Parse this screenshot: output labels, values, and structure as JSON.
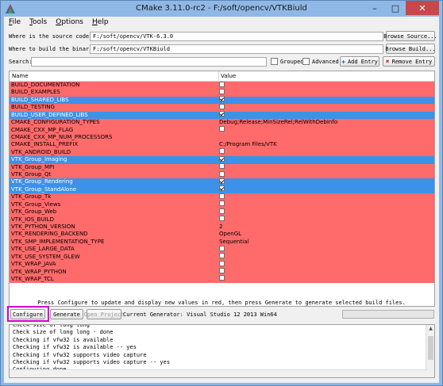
{
  "window": {
    "title": "CMake 3.11.0-rc2 - F:/soft/opencv/VTKBiuld"
  },
  "menu": [
    {
      "key": "F",
      "rest": "ile"
    },
    {
      "key": "T",
      "rest": "ools"
    },
    {
      "key": "O",
      "rest": "ptions"
    },
    {
      "key": "H",
      "rest": "elp"
    }
  ],
  "source": {
    "label": "Where is the source code:",
    "value": "F:/soft/opencv/VTK-6.3.0",
    "browse_label": "Browse Source..."
  },
  "build": {
    "label": "Where to build the binaries:",
    "value": "F:/soft/opencv/VTKBiuld",
    "browse_label": "Browse Build..."
  },
  "search": {
    "label": "Search:",
    "value": "",
    "grouped_label": "Grouped",
    "advanced_label": "Advanced",
    "add_label": "Add Entry",
    "remove_label": "Remove Entry"
  },
  "table": {
    "col_name": "Name",
    "col_value": "Value",
    "rows": [
      {
        "name": "BUILD_DOCUMENTATION",
        "type": "bool",
        "checked": false,
        "selected": false
      },
      {
        "name": "BUILD_EXAMPLES",
        "type": "bool",
        "checked": false,
        "selected": false
      },
      {
        "name": "BUILD_SHARED_LIBS",
        "type": "bool",
        "checked": true,
        "selected": true
      },
      {
        "name": "BUILD_TESTING",
        "type": "bool",
        "checked": false,
        "selected": false
      },
      {
        "name": "BUILD_USER_DEFINED_LIBS",
        "type": "bool",
        "checked": true,
        "selected": true
      },
      {
        "name": "CMAKE_CONFIGURATION_TYPES",
        "type": "text",
        "value": "Debug;Release;MinSizeRel;RelWithDebInfo",
        "selected": false
      },
      {
        "name": "CMAKE_CXX_MP_FLAG",
        "type": "bool",
        "checked": false,
        "selected": false
      },
      {
        "name": "CMAKE_CXX_MP_NUM_PROCESSORS",
        "type": "text",
        "value": "",
        "selected": false
      },
      {
        "name": "CMAKE_INSTALL_PREFIX",
        "type": "text",
        "value": "C:/Program Files/VTK",
        "selected": false
      },
      {
        "name": "VTK_ANDROID_BUILD",
        "type": "bool",
        "checked": false,
        "selected": false
      },
      {
        "name": "VTK_Group_Imaging",
        "type": "bool",
        "checked": true,
        "selected": true
      },
      {
        "name": "VTK_Group_MPI",
        "type": "bool",
        "checked": false,
        "selected": false
      },
      {
        "name": "VTK_Group_Qt",
        "type": "bool",
        "checked": false,
        "selected": false
      },
      {
        "name": "VTK_Group_Rendering",
        "type": "bool",
        "checked": true,
        "selected": true
      },
      {
        "name": "VTK_Group_StandAlone",
        "type": "bool",
        "checked": true,
        "selected": true
      },
      {
        "name": "VTK_Group_Tk",
        "type": "bool",
        "checked": false,
        "selected": false
      },
      {
        "name": "VTK_Group_Views",
        "type": "bool",
        "checked": false,
        "selected": false
      },
      {
        "name": "VTK_Group_Web",
        "type": "bool",
        "checked": false,
        "selected": false
      },
      {
        "name": "VTK_IOS_BUILD",
        "type": "bool",
        "checked": false,
        "selected": false
      },
      {
        "name": "VTK_PYTHON_VERSION",
        "type": "text",
        "value": "2",
        "selected": false
      },
      {
        "name": "VTK_RENDERING_BACKEND",
        "type": "text",
        "value": "OpenGL",
        "selected": false
      },
      {
        "name": "VTK_SMP_IMPLEMENTATION_TYPE",
        "type": "text",
        "value": "Sequential",
        "selected": false
      },
      {
        "name": "VTK_USE_LARGE_DATA",
        "type": "bool",
        "checked": false,
        "selected": false
      },
      {
        "name": "VTK_USE_SYSTEM_GLEW",
        "type": "bool",
        "checked": false,
        "selected": false
      },
      {
        "name": "VTK_WRAP_JAVA",
        "type": "bool",
        "checked": false,
        "selected": false
      },
      {
        "name": "VTK_WRAP_PYTHON",
        "type": "bool",
        "checked": false,
        "selected": false
      },
      {
        "name": "VTK_WRAP_TCL",
        "type": "bool",
        "checked": false,
        "selected": false
      }
    ]
  },
  "status": "Press Configure to update and display new values in red, then press Generate to generate selected build files.",
  "actions": {
    "configure_label": "Configure",
    "generate_label": "Generate",
    "open_project_label": "Open Project",
    "generator_text": "Current Generator: Visual Studio 12 2013 Win64"
  },
  "log": [
    "Check size of long long",
    "Check size of long long - done",
    "Checking if vfw32 is available",
    "Checking if vfw32 is available -- yes",
    "Checking if vfw32 supports video capture",
    "Checking if vfw32 supports video capture -- yes",
    "Configuring done"
  ],
  "colors": {
    "row_red": "#ff6a6a",
    "row_selected": "#3c92e8",
    "highlight": "#d400d4",
    "titlebar": "#8fb8e6"
  },
  "icons": {
    "add": "plus-icon",
    "remove": "x-icon",
    "app": "cmake-triangle-icon"
  }
}
